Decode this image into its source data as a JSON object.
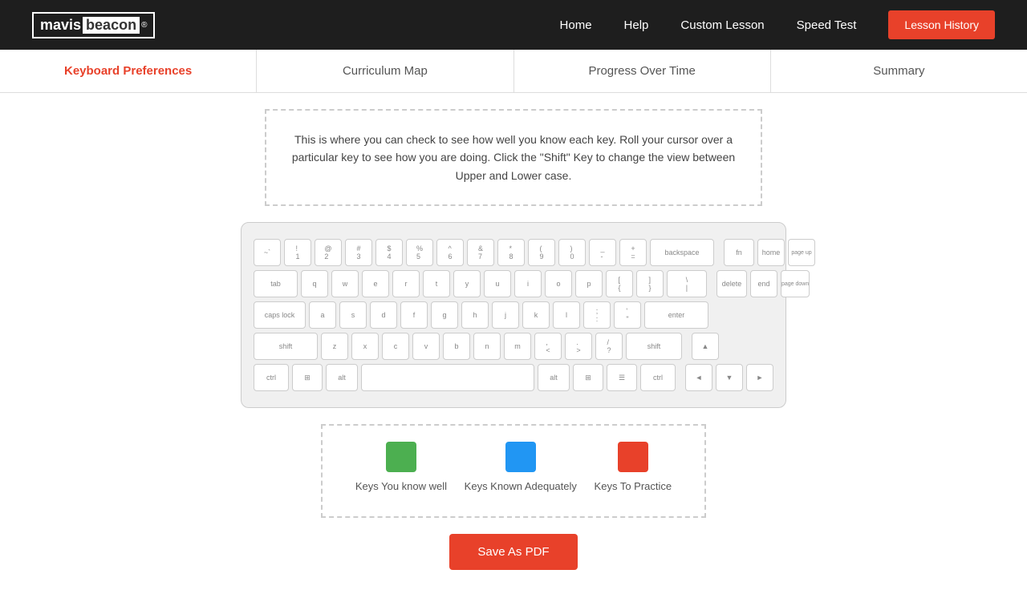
{
  "header": {
    "logo_mavis": "mavis",
    "logo_beacon": "beacon",
    "logo_trademark": "®",
    "nav": {
      "home": "Home",
      "help": "Help",
      "custom_lesson": "Custom Lesson",
      "speed_test": "Speed Test",
      "lesson_history": "Lesson History"
    }
  },
  "tabs": [
    {
      "id": "keyboard-preferences",
      "label": "Keyboard Preferences",
      "active": true
    },
    {
      "id": "curriculum-map",
      "label": "Curriculum Map",
      "active": false
    },
    {
      "id": "progress-over-time",
      "label": "Progress Over Time",
      "active": false
    },
    {
      "id": "summary",
      "label": "Summary",
      "active": false
    }
  ],
  "info_box": {
    "text": "This is where you can check to see how well you know each key. Roll your cursor over a particular key to see how you are doing. Click the \"Shift\" Key to change the view between Upper and Lower case."
  },
  "keyboard": {
    "rows": [
      [
        "~`",
        "!1",
        "@2",
        "#3",
        "$4",
        "%5",
        "^6",
        "&7",
        "*8",
        "(9",
        ")0",
        "_-",
        "+=",
        "backspace"
      ],
      [
        "tab",
        "q",
        "w",
        "e",
        "r",
        "t",
        "y",
        "u",
        "i",
        "o",
        "p",
        "[{",
        "]}",
        "\\|"
      ],
      [
        "caps lock",
        "a",
        "s",
        "d",
        "f",
        "g",
        "h",
        "j",
        "k",
        "l",
        ";:",
        "'\"",
        "enter"
      ],
      [
        "shift",
        "z",
        "x",
        "c",
        "v",
        "b",
        "n",
        "m",
        ",<",
        ".>",
        "/?",
        "shift"
      ],
      [
        "ctrl",
        "win",
        "alt",
        "space",
        "alt",
        "win",
        "menu",
        "ctrl"
      ]
    ]
  },
  "legend": {
    "items": [
      {
        "id": "know-well",
        "color": "#4caf50",
        "label": "Keys You know well"
      },
      {
        "id": "known-adequately",
        "color": "#2196f3",
        "label": "Keys Known Adequately"
      },
      {
        "id": "to-practice",
        "color": "#e8412a",
        "label": "Keys To Practice"
      }
    ]
  },
  "save_button": {
    "label": "Save As PDF"
  }
}
